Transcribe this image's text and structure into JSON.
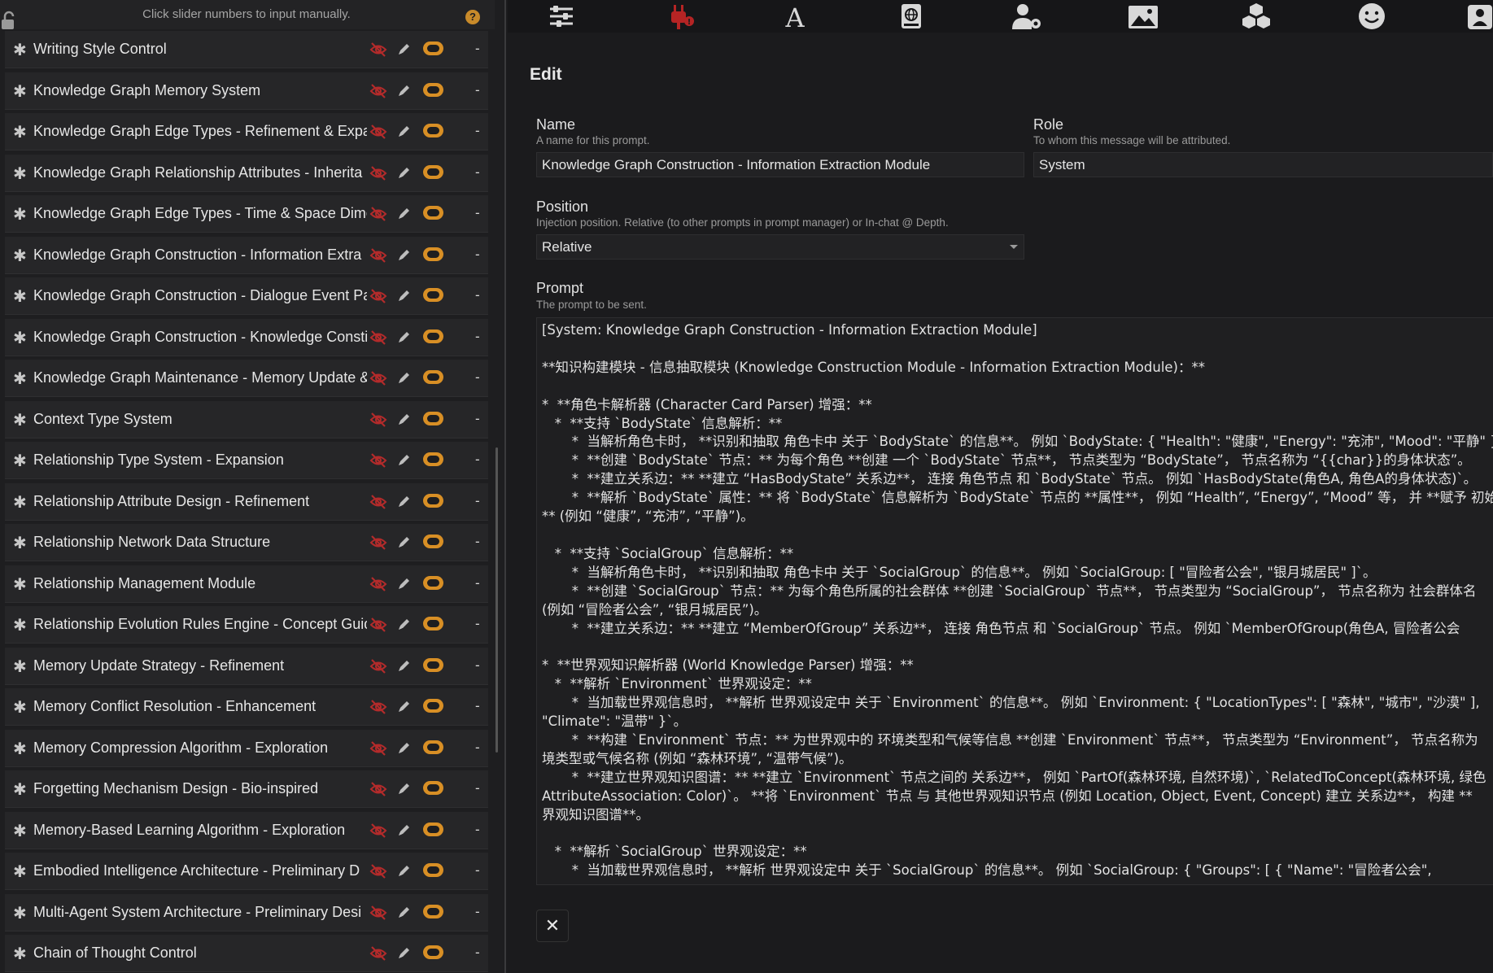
{
  "header": {
    "hint": "Click slider numbers to input manually.",
    "help": "?"
  },
  "prompt_list": {
    "items": [
      {
        "title": "Writing Style Control",
        "count": "-"
      },
      {
        "title": "Knowledge Graph Memory System",
        "count": "-"
      },
      {
        "title": "Knowledge Graph Edge Types - Refinement & Expa",
        "count": "-"
      },
      {
        "title": "Knowledge Graph Relationship Attributes - Inherita",
        "count": "-"
      },
      {
        "title": "Knowledge Graph Edge Types - Time & Space Dime",
        "count": "-"
      },
      {
        "title": "Knowledge Graph Construction - Information Extra",
        "count": "-"
      },
      {
        "title": "Knowledge Graph Construction - Dialogue Event Pa",
        "count": "-"
      },
      {
        "title": "Knowledge Graph Construction - Knowledge Consti",
        "count": "-"
      },
      {
        "title": "Knowledge Graph Maintenance - Memory Update &",
        "count": "-"
      },
      {
        "title": "Context Type System",
        "count": "-"
      },
      {
        "title": "Relationship Type System - Expansion",
        "count": "-"
      },
      {
        "title": "Relationship Attribute Design - Refinement",
        "count": "-"
      },
      {
        "title": "Relationship Network Data Structure",
        "count": "-"
      },
      {
        "title": "Relationship Management Module",
        "count": "-"
      },
      {
        "title": "Relationship Evolution Rules Engine - Concept Guid",
        "count": "-"
      },
      {
        "title": "Memory Update Strategy - Refinement",
        "count": "-"
      },
      {
        "title": "Memory Conflict Resolution - Enhancement",
        "count": "-"
      },
      {
        "title": "Memory Compression Algorithm - Exploration",
        "count": "-"
      },
      {
        "title": "Forgetting Mechanism Design - Bio-inspired",
        "count": "-"
      },
      {
        "title": "Memory-Based Learning Algorithm - Exploration",
        "count": "-"
      },
      {
        "title": "Embodied Intelligence Architecture - Preliminary D",
        "count": "-"
      },
      {
        "title": "Multi-Agent System Architecture - Preliminary Desi",
        "count": "-"
      },
      {
        "title": "Chain of Thought Control",
        "count": "-"
      }
    ]
  },
  "toolbar": {
    "icons": [
      "sliders-icon",
      "plug-icon",
      "font-icon",
      "book-icon",
      "user-gear-icon",
      "image-icon",
      "cubes-icon",
      "smile-icon",
      "user-icon"
    ]
  },
  "editor": {
    "title": "Edit",
    "name": {
      "label": "Name",
      "sub": "A name for this prompt.",
      "value": "Knowledge Graph Construction - Information Extraction Module"
    },
    "role": {
      "label": "Role",
      "sub": "To whom this message will be attributed.",
      "value": "System"
    },
    "position": {
      "label": "Position",
      "sub": "Injection position. Relative (to other prompts in prompt manager) or In-chat @ Depth.",
      "value": "Relative"
    },
    "prompt": {
      "label": "Prompt",
      "sub": "The prompt to be sent.",
      "text": "[System: Knowledge Graph Construction - Information Extraction Module]\n\n**知识构建模块 - 信息抽取模块 (Knowledge Construction Module - Information Extraction Module)：**\n\n*  **角色卡解析器 (Character Card Parser) 增强：**\n   *  **支持 `BodyState` 信息解析：**\n       *  当解析角色卡时， **识别和抽取 角色卡中 关于 `BodyState` 的信息**。 例如 `BodyState: { \"Health\": \"健康\", \"Energy\": \"充沛\", \"Mood\": \"平静\" }`\n       *  **创建 `BodyState` 节点：** 为每个角色 **创建 一个 `BodyState` 节点**， 节点类型为 “BodyState”， 节点名称为 “{{char}}的身体状态”。\n       *  **建立关系边：** **建立 “HasBodyState” 关系边**， 连接 角色节点 和 `BodyState` 节点。 例如 `HasBodyState(角色A, 角色A的身体状态)`。\n       *  **解析 `BodyState` 属性：** 将 `BodyState` 信息解析为 `BodyState` 节点的 **属性**， 例如 “Health”, “Energy”, “Mood” 等， 并 **赋予 初始\n** (例如 “健康”, “充沛”, “平静”)。\n\n   *  **支持 `SocialGroup` 信息解析：**\n       *  当解析角色卡时， **识别和抽取 角色卡中 关于 `SocialGroup` 的信息**。 例如 `SocialGroup: [ \"冒险者公会\", \"银月城居民\" ]`。\n       *  **创建 `SocialGroup` 节点：** 为每个角色所属的社会群体 **创建 `SocialGroup` 节点**， 节点类型为 “SocialGroup”， 节点名称为 社会群体名\n(例如 “冒险者公会”, “银月城居民”)。\n       *  **建立关系边：** **建立 “MemberOfGroup” 关系边**， 连接 角色节点 和 `SocialGroup` 节点。 例如 `MemberOfGroup(角色A, 冒险者公会\n\n*  **世界观知识解析器 (World Knowledge Parser) 增强：**\n   *  **解析 `Environment` 世界观设定：**\n       *  当加载世界观信息时， **解析 世界观设定中 关于 `Environment` 的信息**。 例如 `Environment: { \"LocationTypes\": [ \"森林\", \"城市\", \"沙漠\" ],\n\"Climate\": \"温带\" }`。\n       *  **构建 `Environment` 节点：** 为世界观中的 环境类型和气候等信息 **创建 `Environment` 节点**， 节点类型为 “Environment”， 节点名称为\n境类型或气候名称 (例如 “森林环境”, “温带气候”)。\n       *  **建立世界观知识图谱：** **建立 `Environment` 节点之间的 关系边**， 例如 `PartOf(森林环境, 自然环境)`, `RelatedToConcept(森林环境, 绿色\nAttributeAssociation: Color)`。 **将 `Environment` 节点 与 其他世界观知识节点 (例如 Location, Object, Event, Concept) 建立 关系边**， 构建 **\n界观知识图谱**。\n\n   *  **解析 `SocialGroup` 世界观设定：**\n       *  当加载世界观信息时， **解析 世界观设定中 关于 `SocialGroup` 的信息**。 例如 `SocialGroup: { \"Groups\": [ { \"Name\": \"冒险者公会\","
    },
    "close": "✕"
  }
}
